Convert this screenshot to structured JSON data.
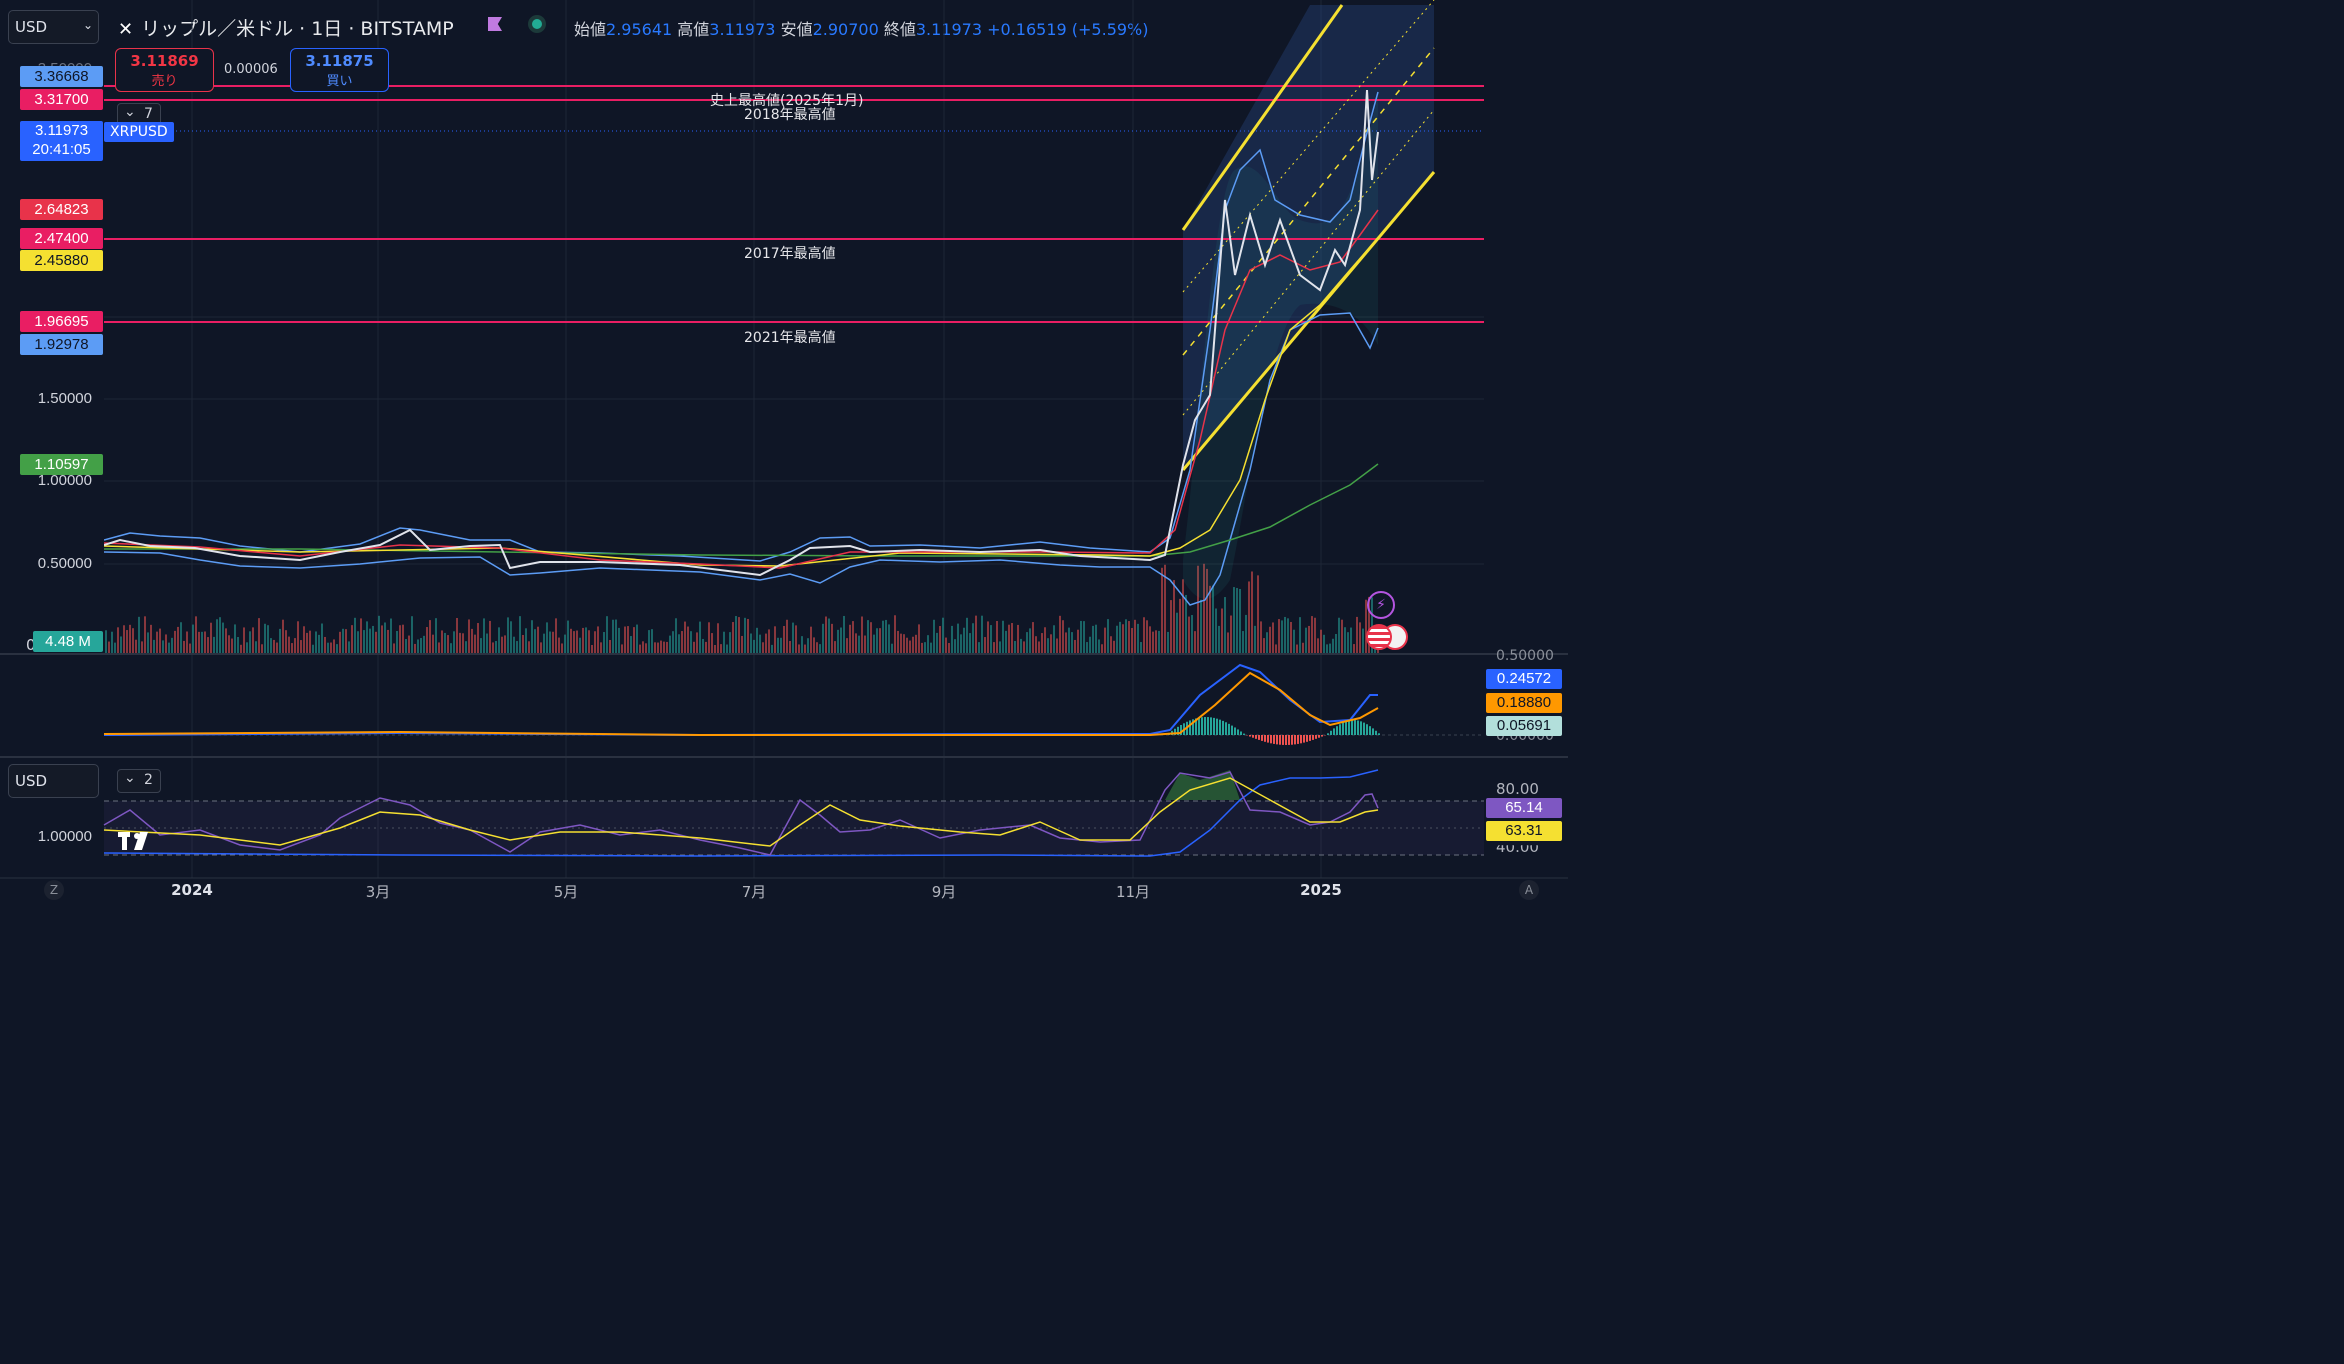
{
  "toolbar": {
    "currency": "USD",
    "symbol_title": "リップル／米ドル · 1日 · BITSTAMP",
    "open_label": "始値",
    "open": "2.95641",
    "high_label": "高値",
    "high": "3.11973",
    "low_label": "安値",
    "low": "2.90700",
    "close_label": "終値",
    "close": "3.11973",
    "change": "+0.16519 (+5.59%)"
  },
  "trade": {
    "sell_price": "3.11869",
    "sell_label": "売り",
    "spread": "0.00006",
    "buy_price": "3.11875",
    "buy_label": "買い"
  },
  "legend": {
    "indicators_count": "7",
    "symbol_tag": "XRPUSD"
  },
  "price_axis": {
    "partial_top": "3.50000",
    "labels": [
      {
        "text": "3.36668",
        "color": "#5c9cf5"
      },
      {
        "text": "3.31700",
        "color": "#e91e63"
      },
      {
        "text": "3.11973",
        "color": "#2962ff"
      },
      {
        "text": "20:41:05",
        "color": "#2962ff"
      },
      {
        "text": "2.64823",
        "color": "#e8334a"
      },
      {
        "text": "2.47400",
        "color": "#e91e63"
      },
      {
        "text": "2.45880",
        "color": "#f5e031"
      },
      {
        "text": "1.96695",
        "color": "#e91e63"
      },
      {
        "text": "1.92978",
        "color": "#5c9cf5"
      },
      {
        "text": "1.10597",
        "color": "#43a047"
      },
      {
        "text": "4.48 M",
        "color": "#26a69a"
      }
    ],
    "ticks": [
      "1.50000",
      "1.00000",
      "0.50000"
    ],
    "zero": "0"
  },
  "annotations": {
    "ath": "史上最高値(2025年1月)",
    "high2018": "2018年最高値",
    "high2017": "2017年最高値",
    "high2021": "2021年最高値"
  },
  "macd_axis": {
    "top_partial": "0.50000",
    "bottom_partial": "0.00000",
    "values": [
      {
        "text": "0.24572",
        "color": "#2962ff"
      },
      {
        "text": "0.18880",
        "color": "#ff9800"
      },
      {
        "text": "0.05691",
        "color": "#b2dfdb"
      }
    ]
  },
  "rsi_panel": {
    "currency": "USD",
    "indicators_count": "2",
    "left_tick": "1.00000",
    "ticks": [
      "80.00",
      "40.00"
    ],
    "values": [
      {
        "text": "65.14",
        "color": "#7e57c2"
      },
      {
        "text": "63.31",
        "color": "#f5e031"
      }
    ]
  },
  "time_axis": {
    "labels": [
      "2024",
      "3月",
      "5月",
      "7月",
      "9月",
      "11月",
      "2025"
    ]
  },
  "corner": {
    "left": "Z",
    "right": "A"
  },
  "chart_data": [
    {
      "type": "line",
      "title": "リップル／米ドル · 1日 · BITSTAMP",
      "x": [
        "2023-12-05",
        "2024-01-01",
        "2024-02-01",
        "2024-03-01",
        "2024-03-11",
        "2024-04-01",
        "2024-04-13",
        "2024-05-01",
        "2024-06-01",
        "2024-07-01",
        "2024-07-05",
        "2024-08-01",
        "2024-09-01",
        "2024-10-01",
        "2024-11-01",
        "2024-11-10",
        "2024-11-20",
        "2024-12-03",
        "2024-12-15",
        "2024-12-31",
        "2025-01-10",
        "2025-01-16",
        "2025-01-21"
      ],
      "series": [
        {
          "values": [
            0.62,
            0.6,
            0.52,
            0.58,
            0.7,
            0.6,
            0.5,
            0.52,
            0.5,
            0.47,
            0.42,
            0.59,
            0.57,
            0.58,
            0.52,
            0.56,
            1.1,
            2.65,
            2.4,
            2.08,
            2.35,
            3.37,
            3.12
          ]
        }
      ],
      "hlines": [
        {
          "y": 3.317,
          "label": "2018年最高値"
        },
        {
          "y": 3.36668,
          "label": "史上最高値(2025年1月)"
        },
        {
          "y": 2.474,
          "label": "2017年最高値"
        },
        {
          "y": 1.96695,
          "label": "2021年最高値"
        }
      ],
      "ylim": [
        0,
        3.5
      ]
    },
    {
      "type": "line",
      "x": [
        "2023-12-05",
        "2024-11-10",
        "2024-11-25",
        "2024-12-03",
        "2024-12-20",
        "2025-01-01",
        "2025-01-15",
        "2025-01-21"
      ],
      "series": [
        {
          "values": [
            0.002,
            0.002,
            0.2,
            0.4,
            0.25,
            0.05,
            0.15,
            0.24572
          ]
        },
        {
          "values": [
            0.002,
            0.002,
            0.12,
            0.33,
            0.28,
            0.07,
            0.12,
            0.1888
          ]
        }
      ]
    },
    {
      "type": "line",
      "x": [
        "2023-12-05",
        "2024-01-20",
        "2024-03-11",
        "2024-04-13",
        "2024-06-01",
        "2024-07-05",
        "2024-07-20",
        "2024-09-01",
        "2024-10-20",
        "2024-11-10",
        "2024-11-25",
        "2024-12-10",
        "2025-01-01",
        "2025-01-16",
        "2025-01-21"
      ],
      "series": [
        {
          "values": [
            55,
            40,
            72,
            30,
            55,
            28,
            70,
            50,
            58,
            42,
            85,
            70,
            52,
            80,
            65.14
          ]
        },
        {
          "values": [
            55,
            45,
            65,
            40,
            50,
            35,
            62,
            52,
            55,
            48,
            78,
            70,
            55,
            68,
            63.31
          ]
        }
      ],
      "ylim": [
        20,
        100
      ]
    }
  ]
}
